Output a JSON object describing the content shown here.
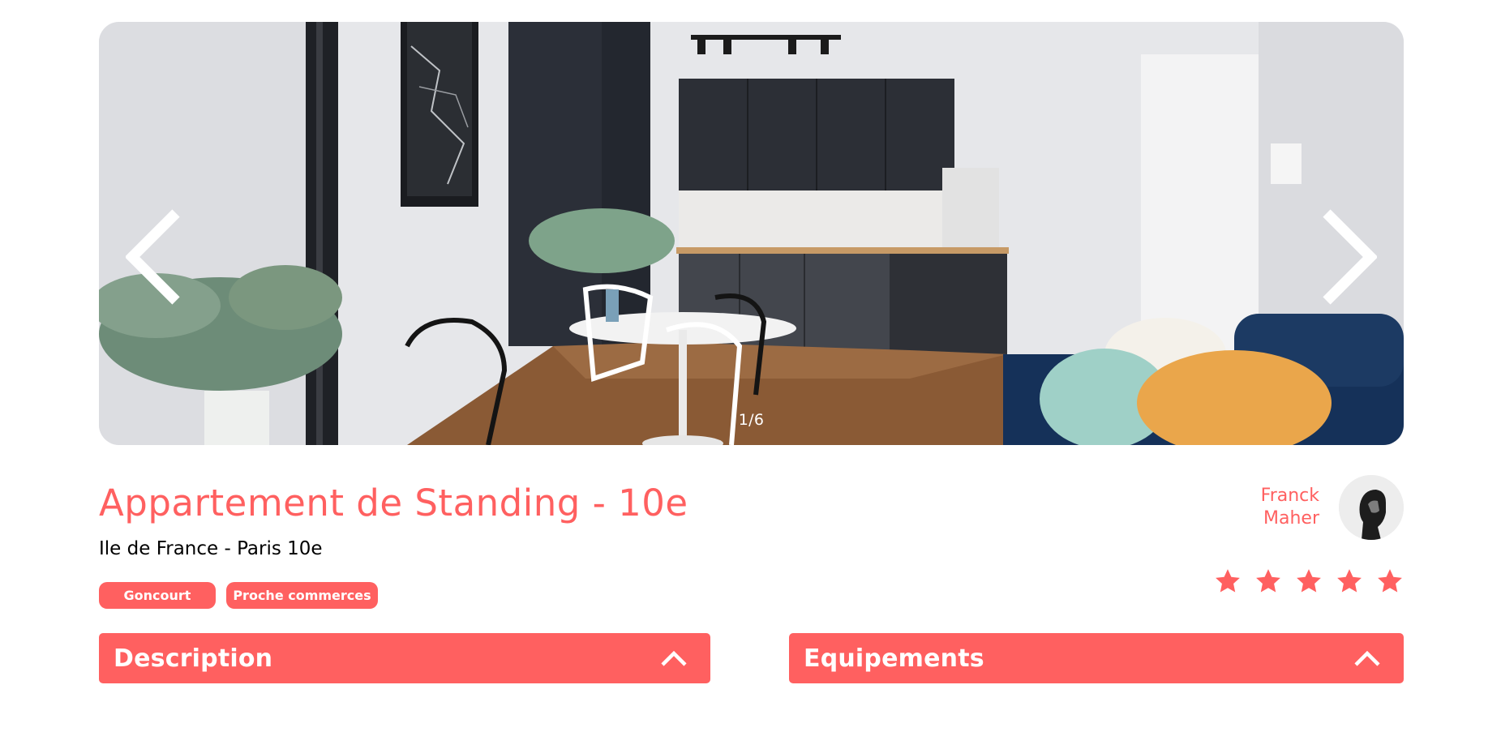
{
  "carousel": {
    "counter": "1/6",
    "prev_icon": "chevron-left-icon",
    "next_icon": "chevron-right-icon"
  },
  "listing": {
    "title": "Appartement de Standing - 10e",
    "location": "Ile de France - Paris 10e",
    "tags": [
      "Goncourt",
      "Proche commerces"
    ]
  },
  "host": {
    "first_name": "Franck",
    "last_name": "Maher"
  },
  "rating": {
    "value": 5,
    "max": 5
  },
  "sections": {
    "description": "Description",
    "equipments": "Equipements"
  },
  "colors": {
    "accent": "#FF6060",
    "star_active": "#FF6060",
    "text": "#000000",
    "counter_text": "#FFFFFF"
  }
}
